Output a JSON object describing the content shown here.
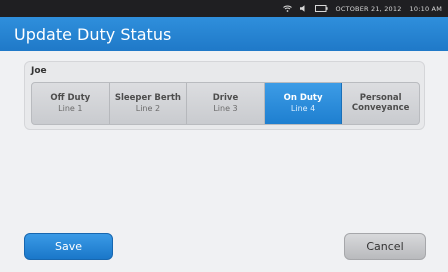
{
  "status_bar": {
    "wifi_icon": "wifi-icon",
    "volume_icon": "speaker-icon",
    "battery_icon": "battery-icon",
    "date": "OCTOBER 21, 2012",
    "time": "10:10 AM"
  },
  "header": {
    "title": "Update Duty Status"
  },
  "driver": {
    "name": "Joe",
    "statuses": [
      {
        "title": "Off Duty",
        "subtitle": "Line 1",
        "selected": false
      },
      {
        "title": "Sleeper Berth",
        "subtitle": "Line 2",
        "selected": false
      },
      {
        "title": "Drive",
        "subtitle": "Line 3",
        "selected": false
      },
      {
        "title": "On Duty",
        "subtitle": "Line 4",
        "selected": true
      },
      {
        "title": "Personal Conveyance",
        "subtitle": "",
        "selected": false
      }
    ]
  },
  "actions": {
    "save_label": "Save",
    "cancel_label": "Cancel"
  },
  "colors": {
    "accent": "#2a8ad8",
    "statusbar": "#1f1f22",
    "background": "#f0f1f3"
  }
}
